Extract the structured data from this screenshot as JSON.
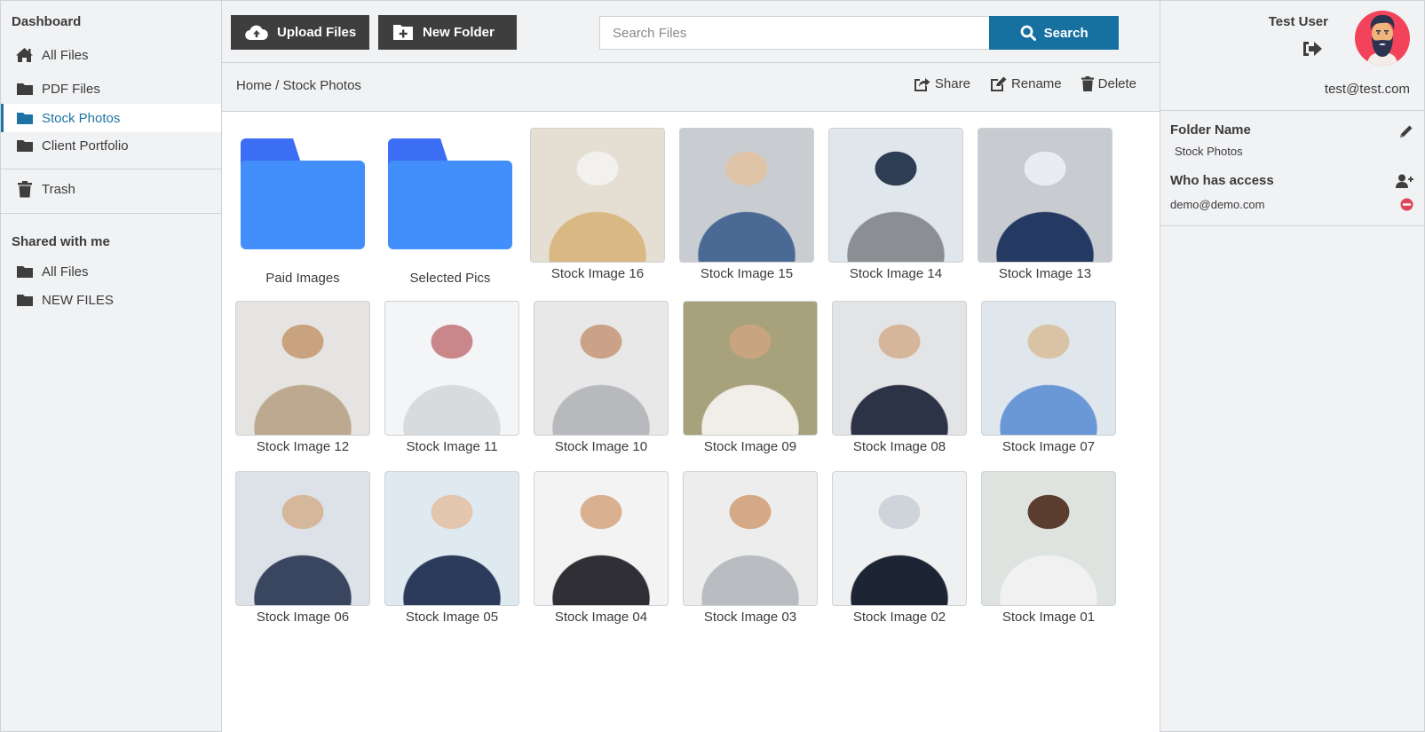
{
  "sidebar": {
    "dashboard_heading": "Dashboard",
    "items": [
      {
        "label": "All Files",
        "icon": "home-icon"
      },
      {
        "label": "PDF Files",
        "icon": "folder-icon"
      },
      {
        "label": "Stock Photos",
        "icon": "folder-icon",
        "active": true
      },
      {
        "label": "Client Portfolio",
        "icon": "folder-icon"
      }
    ],
    "trash_label": "Trash",
    "shared_heading": "Shared with me",
    "shared_items": [
      {
        "label": "All Files",
        "icon": "folder-icon"
      },
      {
        "label": "NEW FILES",
        "icon": "folder-icon"
      }
    ]
  },
  "toolbar": {
    "upload_label": "Upload Files",
    "new_folder_label": "New Folder",
    "search_placeholder": "Search Files",
    "search_value": "",
    "search_button_label": "Search"
  },
  "breadcrumb": {
    "home": "Home",
    "separator": " / ",
    "current": "Stock Photos"
  },
  "actions": {
    "share": "Share",
    "rename": "Rename",
    "delete": "Delete"
  },
  "folders": [
    {
      "name": "Paid Images"
    },
    {
      "name": "Selected Pics"
    }
  ],
  "images": [
    {
      "name": "Stock Image 16",
      "palette": [
        "#e4dfd2",
        "#d9b884",
        "#f3f1ee"
      ]
    },
    {
      "name": "Stock Image 15",
      "palette": [
        "#c9cdd1",
        "#4a6a95",
        "#e0c4a8"
      ]
    },
    {
      "name": "Stock Image 14",
      "palette": [
        "#dfe6ec",
        "#8b8f93",
        "#2e3c54"
      ]
    },
    {
      "name": "Stock Image 13",
      "palette": [
        "#c8ccd0",
        "#253a63",
        "#e9edf2"
      ]
    },
    {
      "name": "Stock Image 12",
      "palette": [
        "#e6e4e2",
        "#bda98f",
        "#c9a37e"
      ]
    },
    {
      "name": "Stock Image 11",
      "palette": [
        "#f3f5f6",
        "#d7dbdd",
        "#c9878c"
      ]
    },
    {
      "name": "Stock Image 10",
      "palette": [
        "#e8e8e8",
        "#b7b9bc",
        "#caa288"
      ]
    },
    {
      "name": "Stock Image 09",
      "palette": [
        "#a8a27c",
        "#f1ede8",
        "#c8a57f"
      ]
    },
    {
      "name": "Stock Image 08",
      "palette": [
        "#e3e4e6",
        "#2d3346",
        "#d6b69a"
      ]
    },
    {
      "name": "Stock Image 07",
      "palette": [
        "#dfe6ec",
        "#6a98d6",
        "#d9c3a4"
      ]
    },
    {
      "name": "Stock Image 06",
      "palette": [
        "#dde2e8",
        "#3a4660",
        "#d5b89c"
      ]
    },
    {
      "name": "Stock Image 05",
      "palette": [
        "#dfe9f0",
        "#2c3a5c",
        "#e2c6ad"
      ]
    },
    {
      "name": "Stock Image 04",
      "palette": [
        "#f3f3f3",
        "#2f2f35",
        "#d9b191"
      ]
    },
    {
      "name": "Stock Image 03",
      "palette": [
        "#ededed",
        "#b9bcc0",
        "#d4a987"
      ]
    },
    {
      "name": "Stock Image 02",
      "palette": [
        "#eef0f1",
        "#1d2433",
        "#cfd4da"
      ]
    },
    {
      "name": "Stock Image 01",
      "palette": [
        "#dfe3e0",
        "#f1f1f1",
        "#5b3d2e"
      ]
    }
  ],
  "user": {
    "name": "Test User",
    "email": "test@test.com"
  },
  "details": {
    "folder_name_label": "Folder Name",
    "folder_name_value": "Stock Photos",
    "access_label": "Who has access",
    "access_list": [
      {
        "email": "demo@demo.com"
      }
    ]
  },
  "colors": {
    "accent": "#1670a0",
    "active_link": "#1d74a4",
    "dark_button": "#3e3e3e",
    "folder_blue": "#428ffb",
    "folder_tab": "#3c6ef5",
    "remove_red": "#e0465a",
    "panel_bg": "#f1f2f4"
  }
}
